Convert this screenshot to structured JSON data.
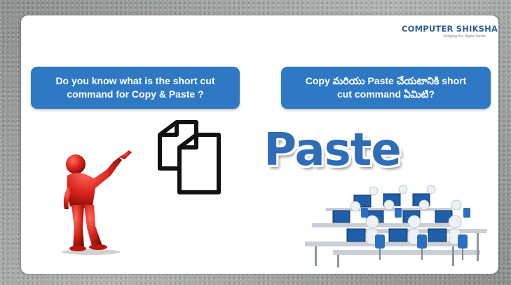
{
  "brand": {
    "name": "COMPUTER SHIKSHA",
    "tagline": "bridging the digital divide"
  },
  "question_english": {
    "line1": "Do you know what is the short cut",
    "line2": "command for Copy & Paste ?"
  },
  "question_telugu": {
    "line1": "Copy మరియు Paste చేయటానికి short",
    "line2": "cut command ఏమిటి?"
  },
  "paste_word": "Paste",
  "colors": {
    "bubble": "#2f79c4",
    "paste_text": "#2f6db6",
    "figure": "#d9241c",
    "brand": "#2f5f8f"
  },
  "icons": [
    "copy-icon",
    "red-pointing-figure",
    "office-computers-image"
  ]
}
